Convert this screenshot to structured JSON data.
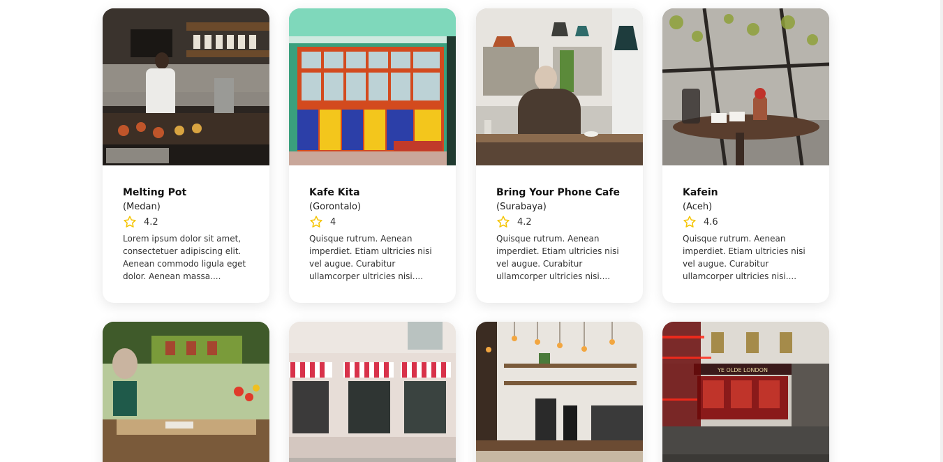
{
  "accent_star_color": "#f5c400",
  "cafes": [
    {
      "name": "Melting Pot",
      "city": "(Medan)",
      "rating": "4.2",
      "description": "Lorem ipsum dolor sit amet, consectetuer adipiscing elit. Aenean commodo ligula eget dolor. Aenean massa....",
      "photo": "coffee-bar-with-barista-photo"
    },
    {
      "name": "Kafe Kita",
      "city": "(Gorontalo)",
      "rating": "4",
      "description": "Quisque rutrum. Aenean imperdiet. Etiam ultricies nisi vel augue. Curabitur ullamcorper ultricies nisi....",
      "photo": "colorful-storefront-photo"
    },
    {
      "name": "Bring Your Phone Cafe",
      "city": "(Surabaya)",
      "rating": "4.2",
      "description": "Quisque rutrum. Aenean imperdiet. Etiam ultricies nisi vel augue. Curabitur ullamcorper ultricies nisi....",
      "photo": "man-sitting-in-cafe-photo"
    },
    {
      "name": "Kafein",
      "city": "(Aceh)",
      "rating": "4.6",
      "description": "Quisque rutrum. Aenean imperdiet. Etiam ultricies nisi vel augue. Curabitur ullamcorper ultricies nisi....",
      "photo": "french-press-table-photo"
    },
    {
      "photo": "garden-terrace-cafe-photo"
    },
    {
      "photo": "striped-awning-storefront-photo"
    },
    {
      "photo": "coffee-counter-with-pendant-lights-photo"
    },
    {
      "photo": "ye-olde-london-pub-photo",
      "sign_text": "YE OLDE LONDON"
    }
  ]
}
